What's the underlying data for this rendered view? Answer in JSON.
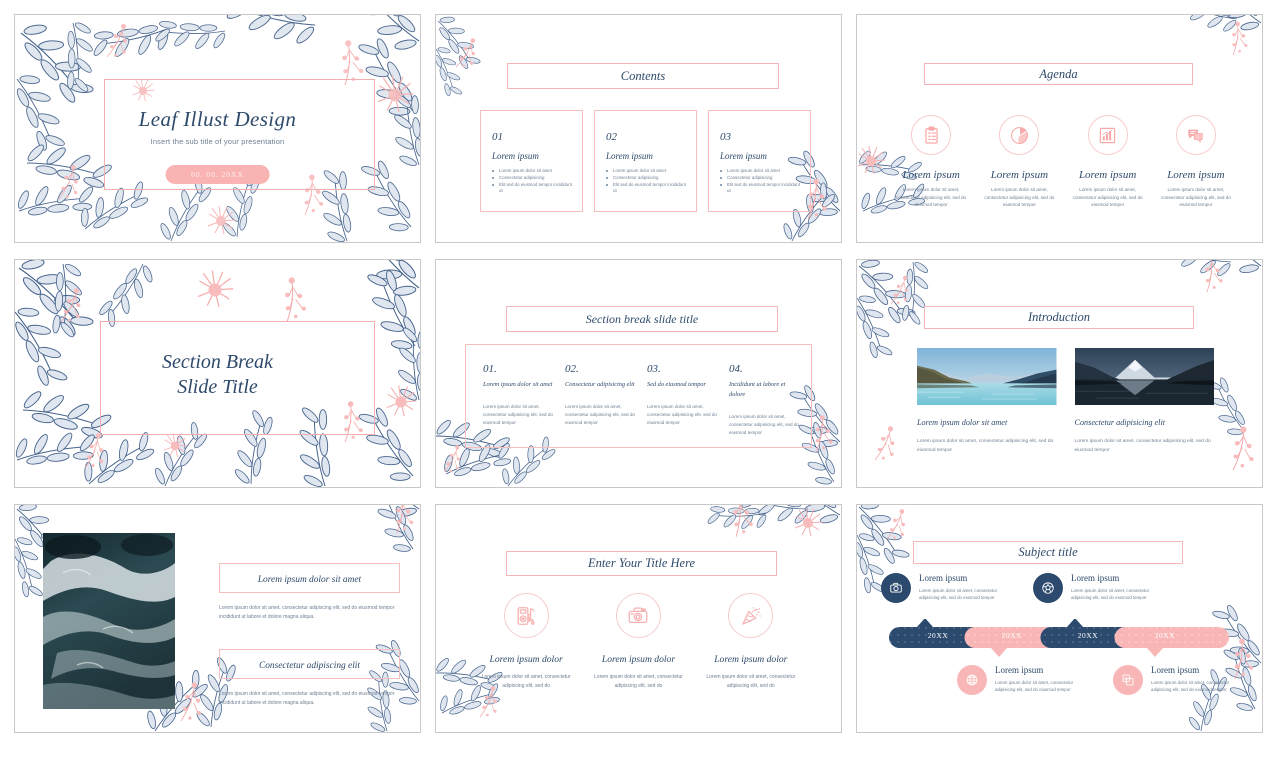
{
  "theme": {
    "navy": "#2e4a6b",
    "pink": "#f8b6b6",
    "pink_light": "#f7cccc",
    "pink_border": "#f6bdbd",
    "body_text": "#6d7f93",
    "slide_border": "#c8c8c8",
    "background": "#ffffff"
  },
  "lorem": {
    "ipsum": "Lorem ipsum",
    "ipsum_dolor": "Lorem ipsum dolor",
    "dolor_sit_amet": "Lorem ipsum dolor sit amet",
    "consectetur": "Consectetur adipisicing elit",
    "short_para": "Lorem ipsum dolor sit amet, consectetur adipisicing elit, sed do eiusmod tempor",
    "medium_para": "Lorem ipsum dolor sit amet, consectetur adipiscing elit, sed do eiusmod tempor incididunt ut labore et dolore magna aliqua.",
    "col_para": "Lorem ipsum dolor sit amet, consectetur adipisicing elit, sed do eiusmod tempor",
    "icon_para": "Lorem ipsum dolor sit amet, consectetur adipiscing elit, sed do"
  },
  "slides": [
    {
      "id": "cover",
      "title": "Leaf Illust Design",
      "subtitle": "Insert the sub title of your presentation",
      "date_badge": "00. 00. 20XX"
    },
    {
      "id": "contents",
      "title": "Contents",
      "cards": [
        {
          "number": "01",
          "heading": "Lorem ipsum",
          "bullets": [
            "Lorem ipsum dolor sit amet",
            "Consectetur adipisicing",
            "Elit sed do eiusmod tempor incididunt ut"
          ]
        },
        {
          "number": "02",
          "heading": "Lorem ipsum",
          "bullets": [
            "Lorem ipsum dolor sit amet",
            "Consectetur adipisicing",
            "Elit sed do eiusmod tempor incididunt ut"
          ]
        },
        {
          "number": "03",
          "heading": "Lorem ipsum",
          "bullets": [
            "Lorem ipsum dolor sit amet",
            "Consectetur adipisicing",
            "Elit sed do eiusmod tempor incididunt ut"
          ]
        }
      ]
    },
    {
      "id": "agenda",
      "title": "Agenda",
      "columns": [
        {
          "icon": "clipboard-checklist-icon",
          "heading": "Lorem ipsum",
          "body": "Lorem ipsum dolor sit amet, consectetur adipisicing elit, sed do eiusmod tempor"
        },
        {
          "icon": "pie-chart-icon",
          "heading": "Lorem ipsum",
          "body": "Lorem ipsum dolor sit amet, consectetur adipisicing elit, sed do eiusmod tempor"
        },
        {
          "icon": "bar-chart-icon",
          "heading": "Lorem ipsum",
          "body": "Lorem ipsum dolor sit amet, consectetur adipisicing elit, sed do eiusmod tempor"
        },
        {
          "icon": "chat-message-icon",
          "heading": "Lorem ipsum",
          "body": "Lorem ipsum dolor sit amet, consectetur adipisicing elit, sed do eiusmod tempor"
        }
      ]
    },
    {
      "id": "section-break",
      "title_line1": "Section Break",
      "title_line2": "Slide Title"
    },
    {
      "id": "section-break-columns",
      "title": "Section break slide title",
      "columns": [
        {
          "number": "01.",
          "heading": "Lorem ipsum dolor sit amet",
          "body": "Lorem ipsum dolor sit amet, consectetur adipisicing elit, sed do eiusmod tempor"
        },
        {
          "number": "02.",
          "heading": "Consectetur adipisicing elit",
          "body": "Lorem ipsum dolor sit amet, consectetur adipisicing elit, sed do eiusmod tempor"
        },
        {
          "number": "03.",
          "heading": "Sed do eiusmod tempor",
          "body": "Lorem ipsum dolor sit amet, consectetur adipisicing elit, sed do eiusmod tempor"
        },
        {
          "number": "04.",
          "heading": "Incididunt ut labore et dolore",
          "body": "Lorem ipsum dolor sit amet, consectetur adipisicing elit, sed do eiusmod tempor"
        }
      ]
    },
    {
      "id": "introduction",
      "title": "Introduction",
      "columns": [
        {
          "photo": "lake-mountains-photo",
          "heading": "Lorem ipsum dolor sit amet",
          "body": "Lorem ipsum dolor sit amet, consectetur adipisicing elit, sed do eiusmod tempor"
        },
        {
          "photo": "snowy-mountain-reflection-photo",
          "heading": "Consectetur adipisicing elit",
          "body": "Lorem ipsum dolor sit amet, consectetur adipisicing elit, sed do eiusmod tempor"
        }
      ]
    },
    {
      "id": "photo-text",
      "photo": "ocean-waves-photo",
      "blocks": [
        {
          "heading": "Lorem ipsum dolor sit amet",
          "body": "Lorem ipsum dolor sit amet, consectetur adipiscing elit, sed do eiusmod tempor incididunt ut labore et dolore magna aliqua."
        },
        {
          "heading": "Consectetur adipiscing elit",
          "body": "Lorem ipsum dolor sit amet, consectetur adipiscing elit, sed do eiusmod tempor incididunt ut labore et dolore magna aliqua."
        }
      ]
    },
    {
      "id": "enter-title",
      "title": "Enter Your Title Here",
      "columns": [
        {
          "icon": "music-player-icon",
          "heading": "Lorem ipsum dolor",
          "body": "Lorem ipsum dolor sit amet, consectetur adipiscing elit, sed do"
        },
        {
          "icon": "camera-icon",
          "heading": "Lorem ipsum dolor",
          "body": "Lorem ipsum dolor sit amet, consectetur adipiscing elit, sed do"
        },
        {
          "icon": "party-popper-icon",
          "heading": "Lorem ipsum dolor",
          "body": "Lorem ipsum dolor sit amet, consectetur adipiscing elit, sed do"
        }
      ]
    },
    {
      "id": "subject-timeline",
      "title": "Subject title",
      "years": [
        "20XX",
        "20XX",
        "20XX",
        "20XX"
      ],
      "items": [
        {
          "position": "top",
          "color": "navy",
          "icon": "camera-icon",
          "heading": "Lorem ipsum",
          "body": "Lorem ipsum dolor sit amet, consectetur adipisicing elit, sed do eiusmod tempor"
        },
        {
          "position": "bottom",
          "color": "pink",
          "icon": "globe-icon",
          "heading": "Lorem ipsum",
          "body": "Lorem ipsum dolor sit amet, consectetur adipisicing elit, sed do eiusmod tempor"
        },
        {
          "position": "top",
          "color": "navy",
          "icon": "soccer-ball-icon",
          "heading": "Lorem ipsum",
          "body": "Lorem ipsum dolor sit amet, consectetur adipisicing elit, sed do eiusmod tempor"
        },
        {
          "position": "bottom",
          "color": "pink",
          "icon": "image-swap-icon",
          "heading": "Lorem ipsum",
          "body": "Lorem ipsum dolor sit amet, consectetur adipisicing elit, sed do eiusmod tempor"
        }
      ]
    }
  ]
}
